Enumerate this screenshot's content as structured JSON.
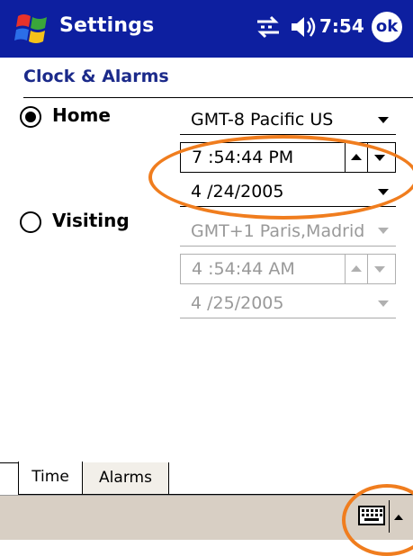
{
  "titlebar": {
    "app_title": "Settings",
    "clock": "7:54",
    "ok_label": "ok"
  },
  "page": {
    "heading": "Clock & Alarms"
  },
  "home": {
    "label": "Home",
    "selected": true,
    "timezone": "GMT-8 Pacific US",
    "time": "7 :54:44 PM",
    "date": "4 /24/2005"
  },
  "visiting": {
    "label": "Visiting",
    "selected": false,
    "timezone": "GMT+1 Paris,Madrid",
    "time": "4 :54:44 AM",
    "date": "4 /25/2005"
  },
  "tabs": [
    {
      "label": "Time",
      "active": true
    },
    {
      "label": "Alarms",
      "active": false
    }
  ],
  "colors": {
    "titlebar": "#0d1fa0",
    "heading": "#1b2a8a",
    "highlight": "#f07d1e",
    "command_bar": "#d8cfc4"
  },
  "icons": [
    "windows-start-icon",
    "connectivity-icon",
    "speaker-icon",
    "ok-icon",
    "keyboard-icon",
    "input-menu-arrow-icon"
  ]
}
